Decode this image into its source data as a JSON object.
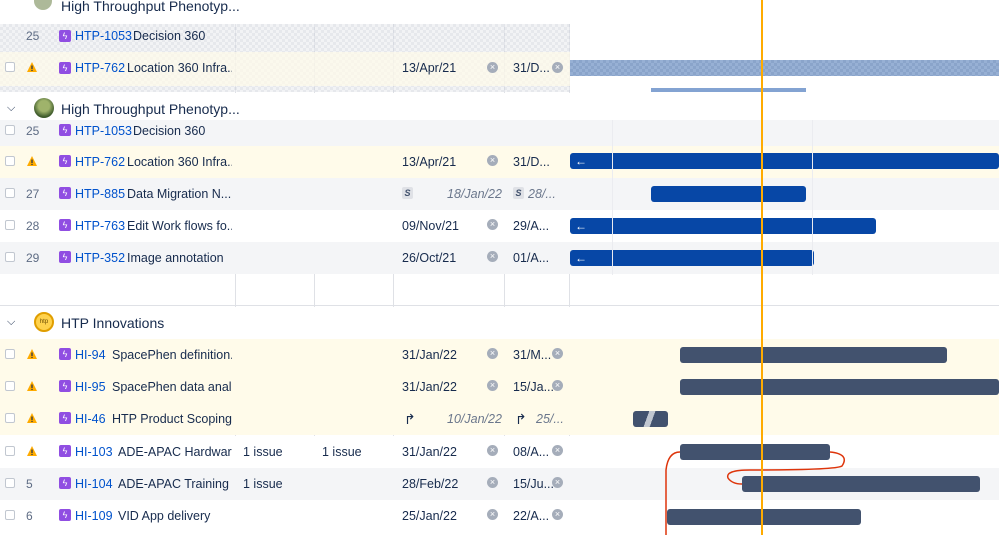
{
  "colors": {
    "link": "#0052cc",
    "warning": "#ffab00",
    "story_type": "#904ee2",
    "bar_blue": "#0747a6",
    "bar_dark": "#42526e",
    "today_line": "#ffab00",
    "dependency": "#de350b"
  },
  "sticky": {
    "group_title": "High Throughput Phenotyp...",
    "row1": {
      "num": "25",
      "key": "HTP-1053",
      "summary": "Decision 360"
    },
    "row2": {
      "key": "HTP-762",
      "summary": "Location 360 Infra...",
      "start": "13/Apr/21",
      "due": "31/D..."
    }
  },
  "groups": [
    {
      "title": "High Throughput Phenotyp...",
      "avatar_icon": "plant-avatar-icon",
      "rows": [
        {
          "num": "25",
          "key": "HTP-1053",
          "summary": "Decision 360",
          "start": "",
          "due": "",
          "warn": false
        },
        {
          "num": "",
          "key": "HTP-762",
          "summary": "Location 360 Infra...",
          "start": "13/Apr/21",
          "due": "31/D...",
          "warn": true
        },
        {
          "num": "27",
          "key": "HTP-885",
          "summary": "Data Migration N...",
          "start": "18/Jan/22",
          "due": "28/...",
          "warn": false,
          "start_badge": "S",
          "due_badge": "S"
        },
        {
          "num": "28",
          "key": "HTP-763",
          "summary": "Edit Work flows fo...",
          "start": "09/Nov/21",
          "due": "29/A...",
          "warn": false
        },
        {
          "num": "29",
          "key": "HTP-352",
          "summary": "Image annotation",
          "start": "26/Oct/21",
          "due": "01/A...",
          "warn": false
        }
      ]
    },
    {
      "title": "HTP Innovations",
      "avatar_icon": "htp-logo-icon",
      "rows": [
        {
          "num": "",
          "key": "HI-94",
          "summary": "SpacePhen definition...",
          "start": "31/Jan/22",
          "due": "31/M...",
          "warn": true
        },
        {
          "num": "",
          "key": "HI-95",
          "summary": "SpacePhen data anal...",
          "start": "31/Jan/22",
          "due": "15/Ja...",
          "warn": true
        },
        {
          "num": "",
          "key": "HI-46",
          "summary": "HTP Product Scoping",
          "start": "10/Jan/22",
          "due": "25/...",
          "warn": true
        },
        {
          "num": "",
          "key": "HI-103",
          "summary": "ADE-APAC Hardwar...",
          "col1": "1 issue",
          "col2": "1 issue",
          "start": "31/Jan/22",
          "due": "08/A...",
          "warn": true
        },
        {
          "num": "5",
          "key": "HI-104",
          "summary": "ADE-APAC Training ...",
          "col1": "1 issue",
          "start": "28/Feb/22",
          "due": "15/Ju...",
          "warn": false
        },
        {
          "num": "6",
          "key": "HI-109",
          "summary": "VID App delivery",
          "start": "25/Jan/22",
          "due": "22/A...",
          "warn": false
        }
      ]
    }
  ]
}
